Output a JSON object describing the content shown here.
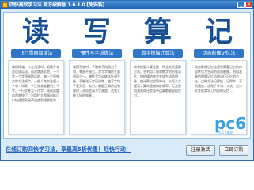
{
  "window": {
    "title": "四快高效学习法 官方破解版 1.6.1.0 [免安装]"
  },
  "panels": [
    {
      "char": "读",
      "subtitle": "飞行贯眼阅读法",
      "text": "我们知道，人在阅读时，眼睛并非是连续运动，而是跳跃式地，一个字一个字停顿地读的，每一个停顿点称为注视点，一般人每次注视一个字，如果一个注视点能看到三个字、一行字甚至一片字，阅读速度自然就快了。利用扩大视幅训练可以快速提高阅读速度和理解能力..."
    },
    {
      "char": "写",
      "subtitle": "弹性写字训练法",
      "text": "我们写字时，手腕和手指用力不均、笔画不规范，是写字慢的主要原因之一。弹性写字训练法针对手指、手腕进行专项训练，使写字的手更灵活、有力，掌握正确的运笔规律，从而提高写字速度，达到又快又好的效果..."
    },
    {
      "char": "算",
      "subtitle": "数字换脑计算法",
      "text": "数字换脑计算法是一种全新的速算方法，它利用人脑对数字的形象记忆，把枯燥的数字变成生动的图像，使计算过程简单化，从而大大提高计算的速度和准确率，无论是加减乘除还是复杂运算都能轻松应对..."
    },
    {
      "char": "记",
      "subtitle": "动态影像记忆法",
      "text": "动态影像记忆法是将需要记忆的内容转化为生动的动态影像，利用右脑的图像记忆功能进行记忆的方法。这种方法记得快、记得牢、不易遗忘，适用于单词、公式、古诗文等各类学习内容的记忆..."
    }
  ],
  "watermark": {
    "text": "pc6",
    "sub": "PC6下载站"
  },
  "footer": {
    "link": "在线订购四快学习法，享最高5折优惠！赶快行动！",
    "button_1": "注册激活",
    "button_2": "立即订购"
  }
}
